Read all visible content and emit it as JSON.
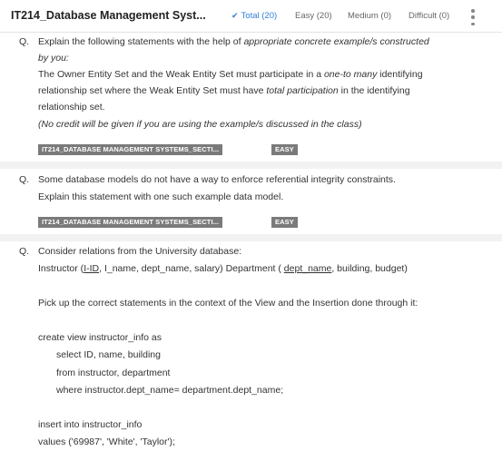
{
  "header": {
    "title": "IT214_Database Management Syst...",
    "filters": {
      "total": "Total (20)",
      "easy": "Easy (20)",
      "medium": "Medium (0)",
      "difficult": "Difficult (0)"
    }
  },
  "questions": [
    {
      "marker": "Q.",
      "lines": {
        "l1a": "Explain the following statements with the help of ",
        "l1b": "appropriate concrete example/s constructed",
        "l2": "by you:",
        "l3a": "The Owner Entity Set and the Weak Entity Set must participate in a ",
        "l3b": "one-to many",
        "l3c": " identifying",
        "l4a": "relationship set where the Weak Entity Set must have ",
        "l4b": "total participation",
        "l4c": " in the identifying",
        "l5": "relationship set.",
        "l6": "(No credit will be given if you are using the example/s discussed in the class)"
      },
      "tags": {
        "course": "IT214_DATABASE MANAGEMENT SYSTEMS_SECTI...",
        "level": "EASY"
      }
    },
    {
      "marker": "Q.",
      "lines": {
        "l1": "Some database models do not have a way to enforce referential integrity constraints.",
        "l2": "Explain this statement with one such example data model."
      },
      "tags": {
        "course": "IT214_DATABASE MANAGEMENT SYSTEMS_SECTI...",
        "level": "EASY"
      }
    },
    {
      "marker": "Q.",
      "lines": {
        "l1": "Consider relations from the University database:",
        "l2a": "Instructor (",
        "l2b": "I-ID",
        "l2c": ", I_name, dept_name, salary)   Department ( ",
        "l2d": "dept_name",
        "l2e": ", building, budget)",
        "l3": "Pick up the correct statements in the context of the View and the Insertion done through it:",
        "l4": "create view instructor_info as",
        "l5": "select ID, name, building",
        "l6": "from instructor, department",
        "l7": "where instructor.dept_name= department.dept_name;",
        "l8": "insert into instructor_info",
        "l9": "values ('69987', 'White', 'Taylor');"
      }
    }
  ]
}
